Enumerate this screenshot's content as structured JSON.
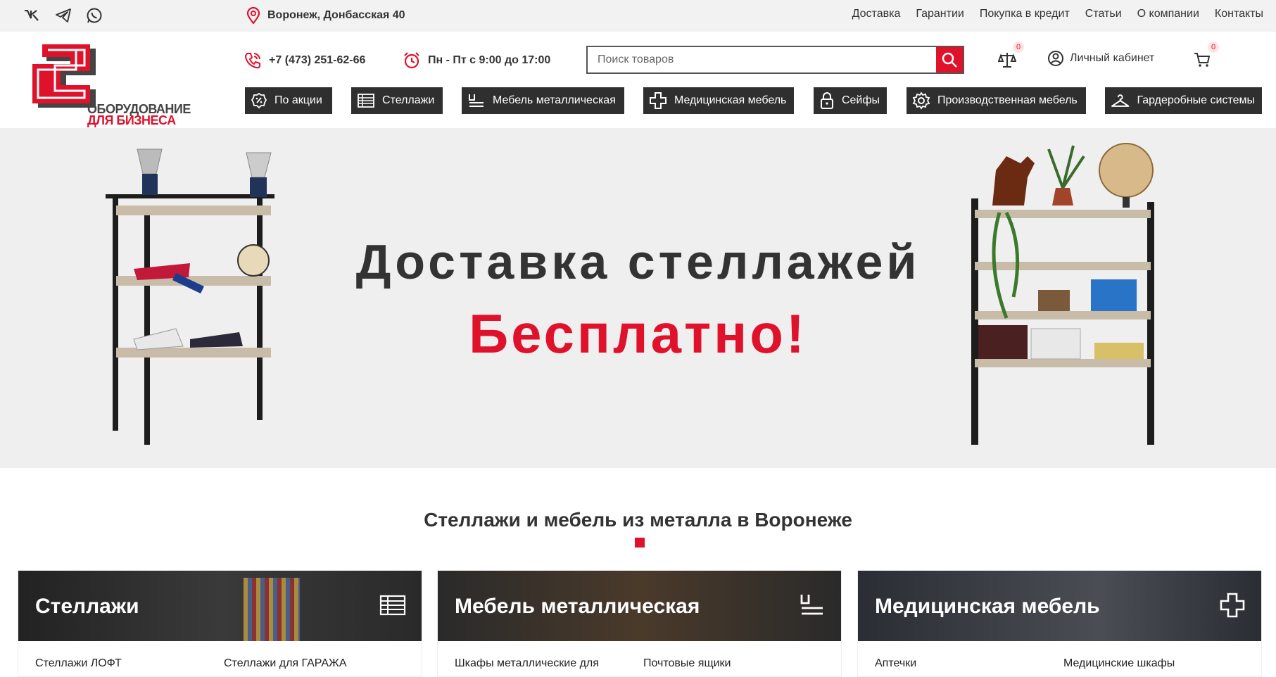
{
  "colors": {
    "brand_red": "#e0112b",
    "dark": "#2f2f2f",
    "hero_bg": "#efefef"
  },
  "topbar": {
    "social": [
      {
        "name": "vk-icon"
      },
      {
        "name": "telegram-icon"
      },
      {
        "name": "whatsapp-icon"
      }
    ],
    "location": "Воронеж, Донбасская 40",
    "links": [
      "Доставка",
      "Гарантии",
      "Покупка в кредит",
      "Статьи",
      "О компании",
      "Контакты"
    ]
  },
  "logo": {
    "line1": "ОБОРУДОВАНИЕ",
    "line2": "ДЛЯ БИЗНЕСА"
  },
  "header": {
    "phone": "+7 (473) 251-62-66",
    "hours": "Пн - Пт с 9:00 до 17:00",
    "search_placeholder": "Поиск товаров",
    "compare_count": "0",
    "account_label": "Личный кабинет",
    "cart_count": "0"
  },
  "categories": [
    {
      "label": "По акции",
      "icon": "percent-badge-icon"
    },
    {
      "label": "Стеллажи",
      "icon": "shelving-icon"
    },
    {
      "label": "Мебель металлическая",
      "icon": "furniture-icon"
    },
    {
      "label": "Медицинская мебель",
      "icon": "medical-cross-icon"
    },
    {
      "label": "Сейфы",
      "icon": "lock-icon"
    },
    {
      "label": "Производственная мебель",
      "icon": "gear-icon"
    },
    {
      "label": "Гардеробные системы",
      "icon": "hanger-icon"
    }
  ],
  "hero": {
    "line1": "Доставка стеллажей",
    "line2": "Бесплатно!"
  },
  "section": {
    "title": "Стеллажи и мебель из металла в Воронеже"
  },
  "cards": [
    {
      "title": "Стеллажи",
      "icon": "shelving-icon",
      "links": [
        "Стеллажи ЛОФТ",
        "Стеллажи для ГАРАЖА"
      ]
    },
    {
      "title": "Мебель металлическая",
      "icon": "furniture-icon",
      "links": [
        "Шкафы металлические для",
        "Почтовые ящики"
      ]
    },
    {
      "title": "Медицинская мебель",
      "icon": "medical-cross-icon",
      "links": [
        "Аптечки",
        "Медицинские шкафы"
      ]
    }
  ]
}
